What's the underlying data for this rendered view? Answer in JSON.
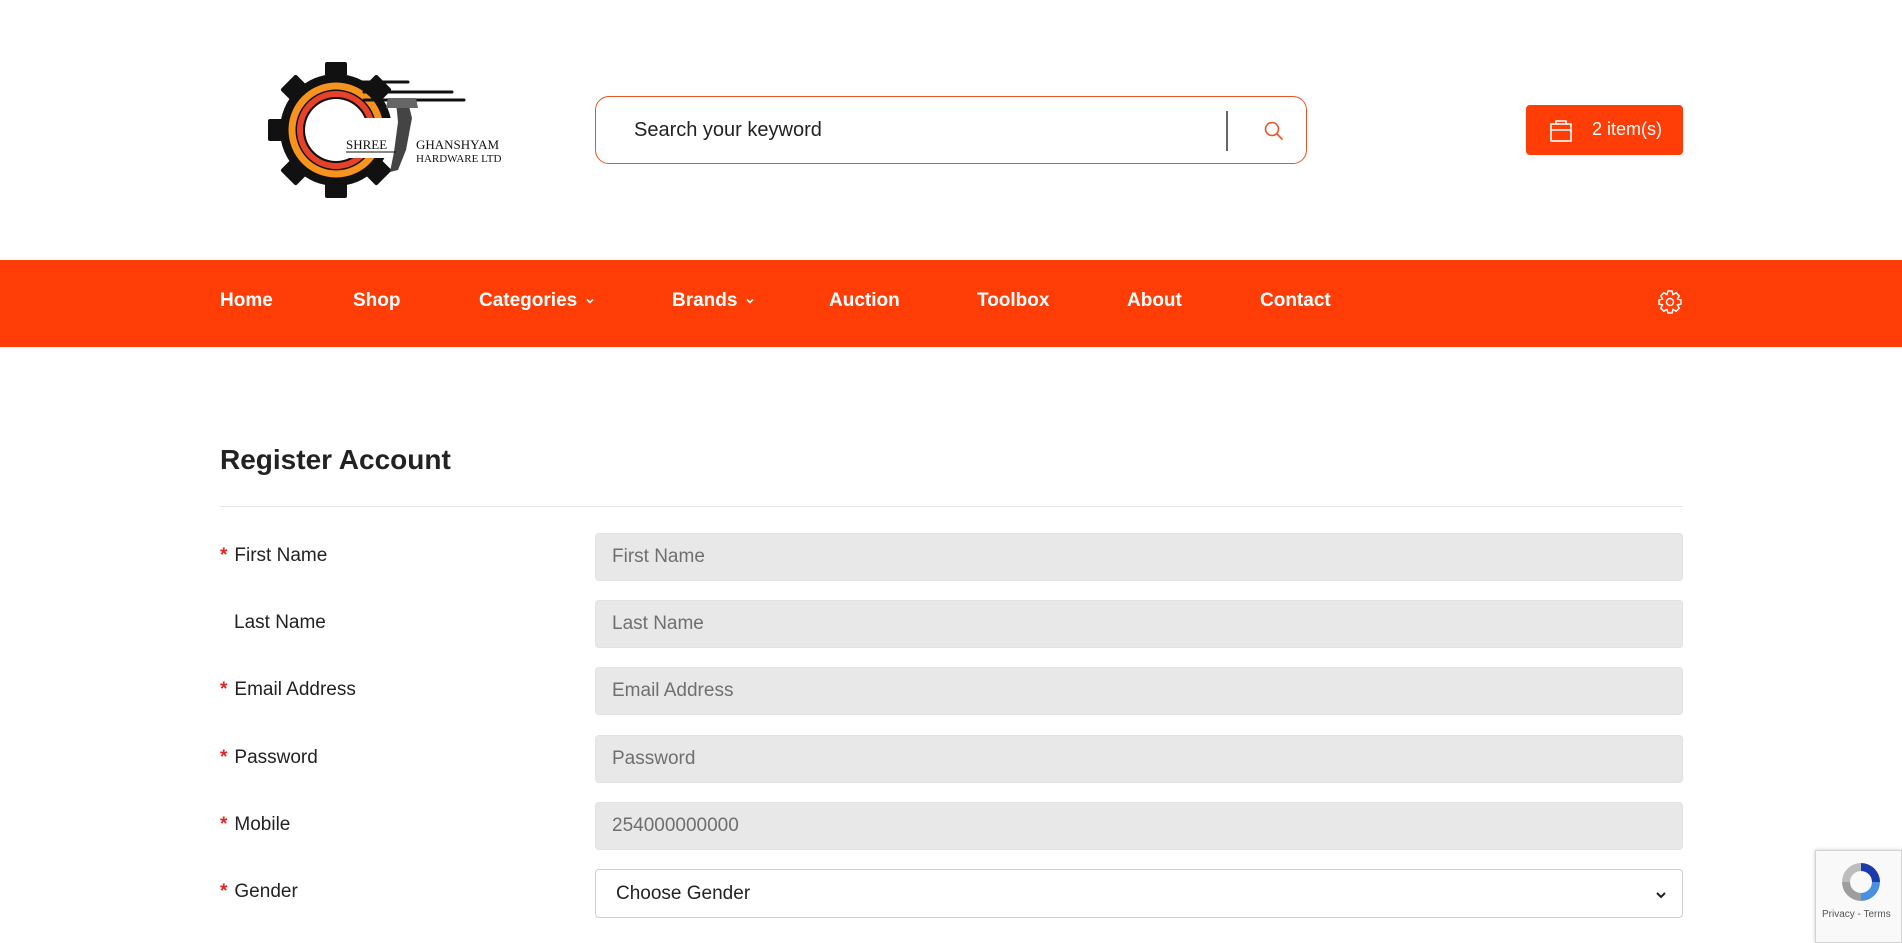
{
  "header": {
    "logo_text_line1": "SHREE",
    "logo_text_line2": "GHANSHYAM",
    "logo_text_line3": "HARDWARE LTD",
    "search_placeholder": "Search your keyword",
    "cart_label": "2 item(s)"
  },
  "nav": {
    "items": [
      {
        "label": "Home"
      },
      {
        "label": "Shop"
      },
      {
        "label": "Categories"
      },
      {
        "label": "Brands"
      },
      {
        "label": "Auction"
      },
      {
        "label": "Toolbox"
      },
      {
        "label": "About"
      },
      {
        "label": "Contact"
      }
    ]
  },
  "form": {
    "title": "Register Account",
    "fields": [
      {
        "label": "First Name",
        "required": true,
        "placeholder": "First Name"
      },
      {
        "label": "Last Name",
        "required": false,
        "placeholder": "Last Name"
      },
      {
        "label": "Email Address",
        "required": true,
        "placeholder": "Email Address"
      },
      {
        "label": "Password",
        "required": true,
        "placeholder": "Password"
      },
      {
        "label": "Mobile",
        "required": true,
        "placeholder": "254000000000"
      },
      {
        "label": "Gender",
        "required": true,
        "selected": "Choose Gender"
      }
    ],
    "required_marker": "*"
  },
  "recaptcha": {
    "links": "Privacy - Terms"
  },
  "colors": {
    "brand": "#ff3d06",
    "search_border": "#e8532a",
    "required": "#e02424",
    "input_bg": "#e8e8e8"
  },
  "icons": {
    "search": "search-icon",
    "cart": "shopping-bag-icon",
    "settings": "gear-icon",
    "chevron": "chevron-down-icon"
  }
}
